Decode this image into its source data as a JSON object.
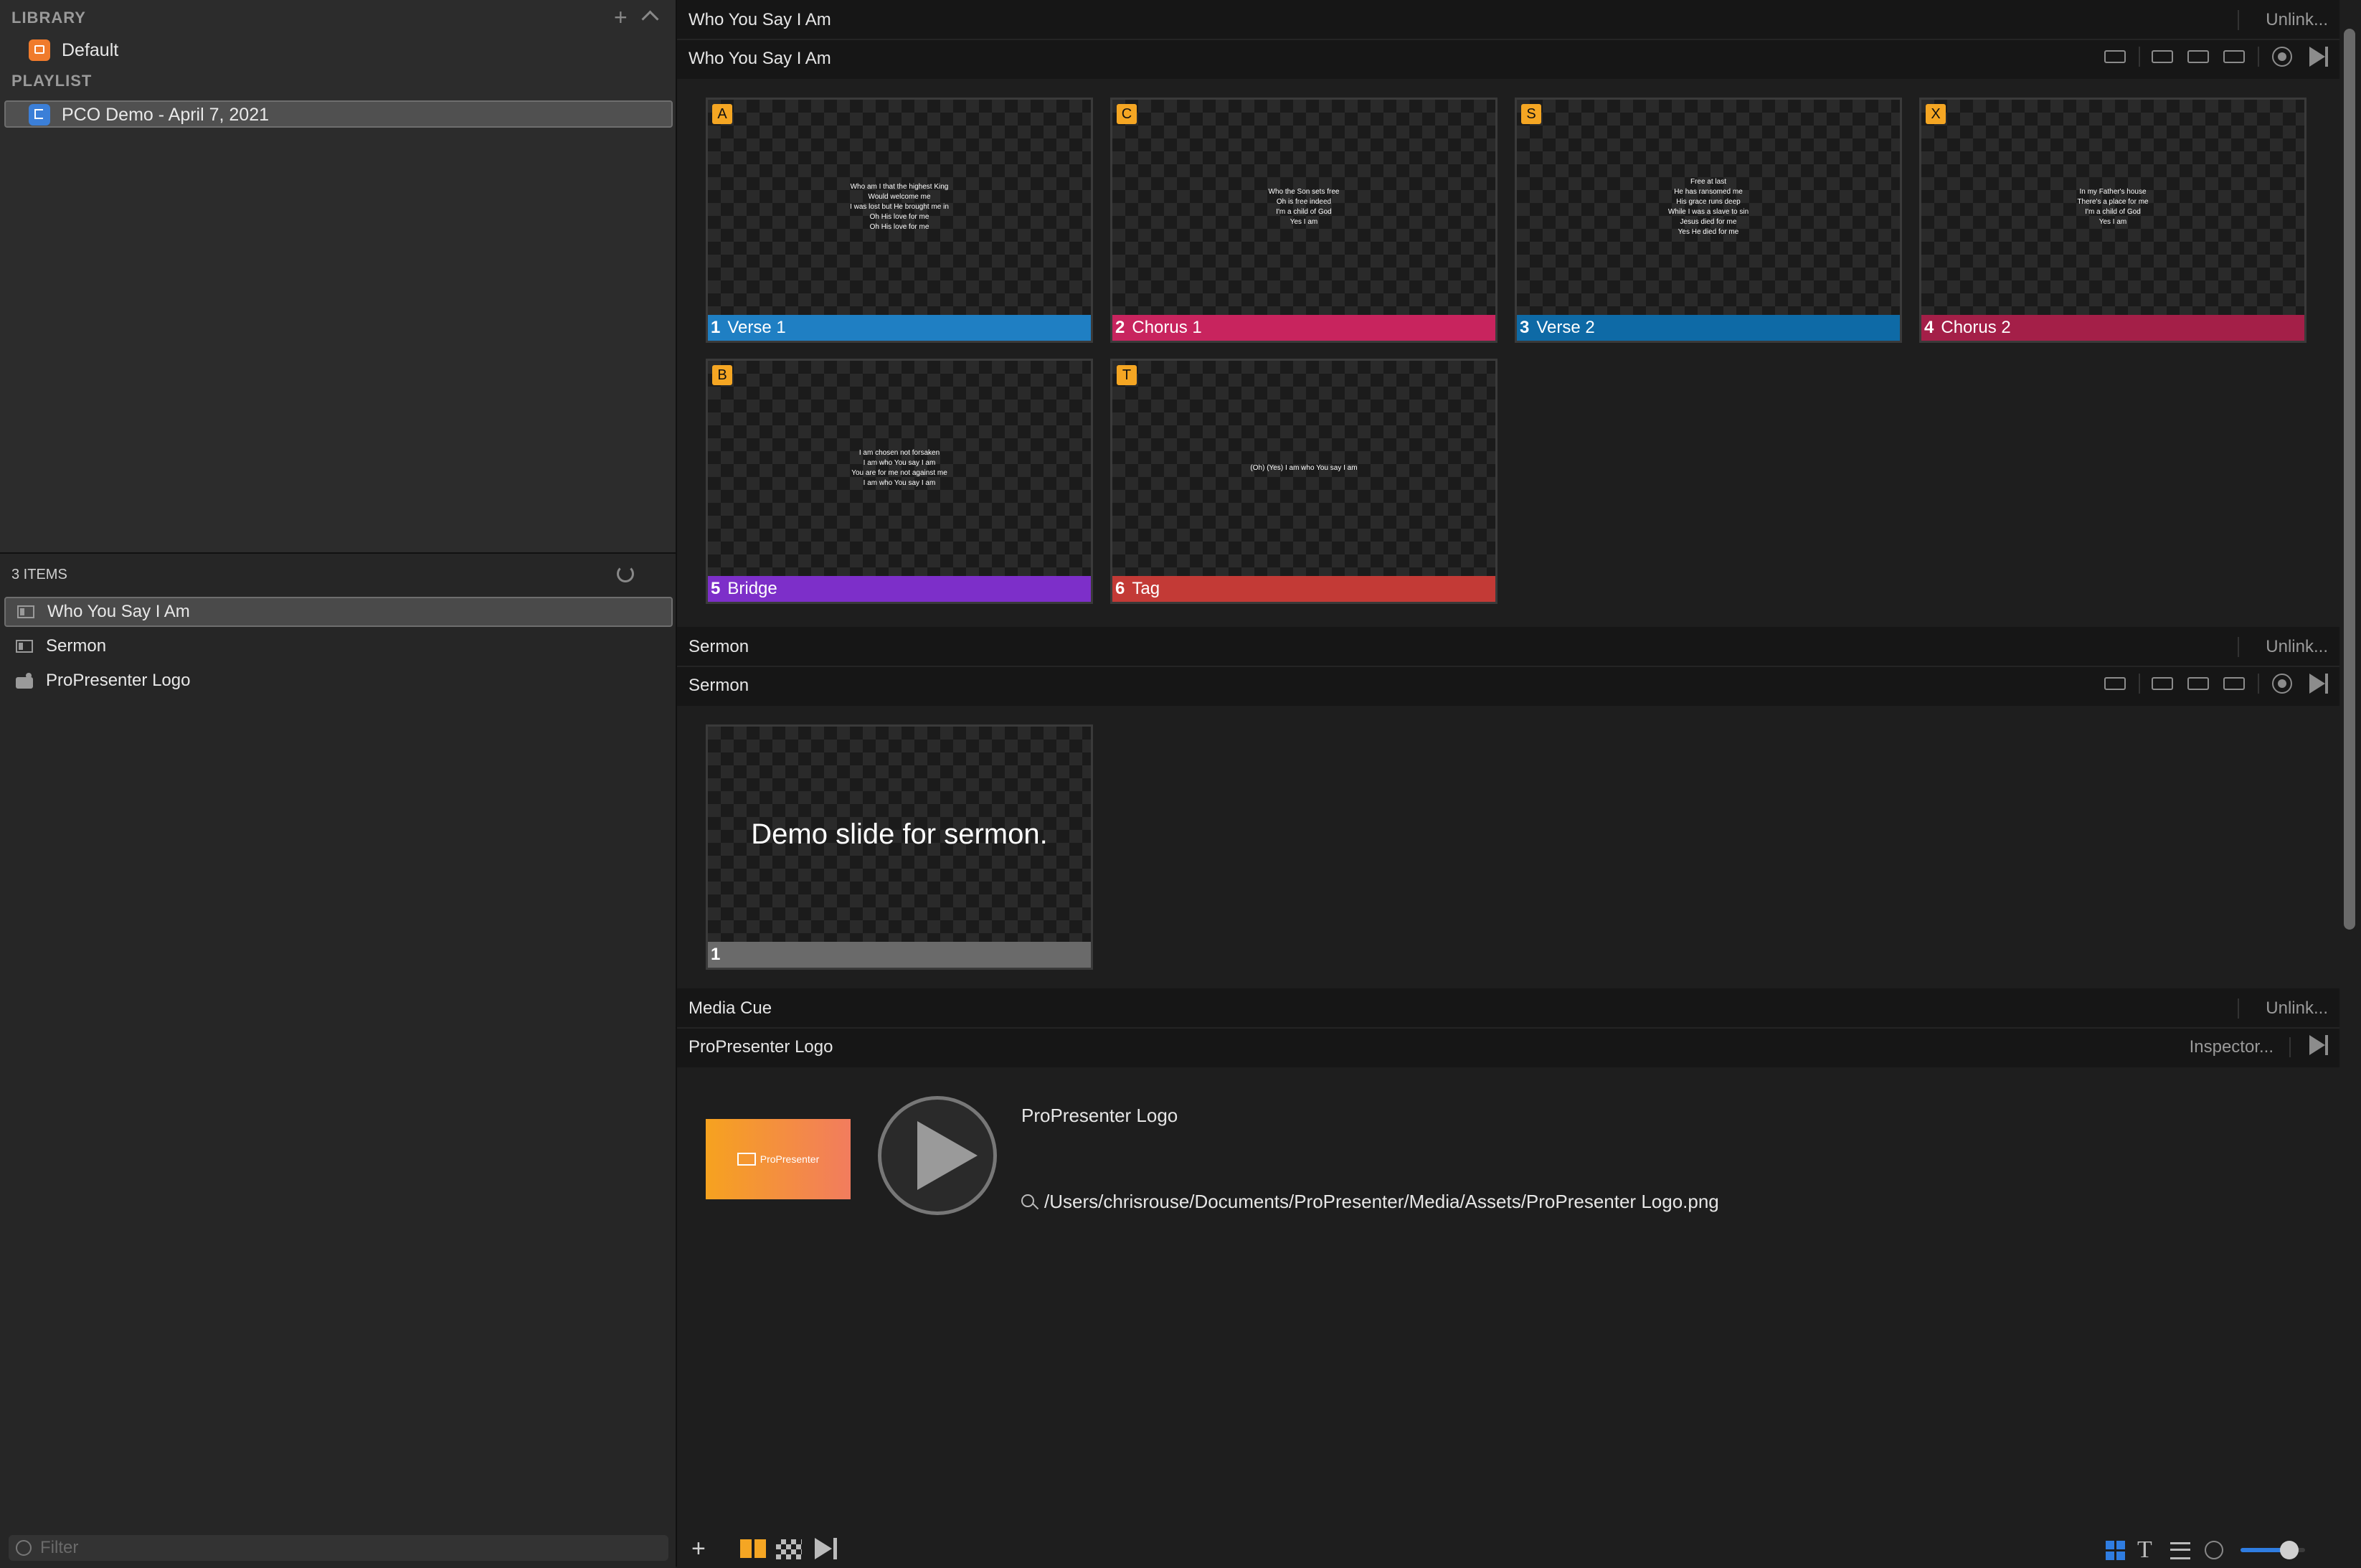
{
  "library": {
    "header": "LIBRARY",
    "items": [
      {
        "label": "Default"
      }
    ]
  },
  "playlist": {
    "header": "PLAYLIST",
    "items": [
      {
        "label": "PCO Demo - April 7, 2021",
        "selected": true
      }
    ]
  },
  "items_panel": {
    "count_label": "3 ITEMS",
    "items": [
      {
        "label": "Who You Say I Am",
        "icon": "document-icon",
        "selected": true
      },
      {
        "label": "Sermon",
        "icon": "document-icon"
      },
      {
        "label": "ProPresenter Logo",
        "icon": "image-icon"
      }
    ],
    "filter_placeholder": "Filter"
  },
  "sections": [
    {
      "group_title": "Who You Say I Am",
      "unlink_label": "Unlink...",
      "title": "Who You Say I Am",
      "slides": [
        {
          "badge": "A",
          "number": "1",
          "label": "Verse 1",
          "color": "#1f7fc3",
          "lyrics": "Who am I that the highest King\nWould welcome me\nI was lost but He brought me in\nOh His love for me\nOh His love for me"
        },
        {
          "badge": "C",
          "number": "2",
          "label": "Chorus 1",
          "color": "#c8245e",
          "lyrics": "Who the Son sets free\nOh is free indeed\nI'm a child of God\nYes I am"
        },
        {
          "badge": "S",
          "number": "3",
          "label": "Verse 2",
          "color": "#0e6aa6",
          "lyrics": "Free at last\nHe has ransomed me\nHis grace runs deep\nWhile I was a slave to sin\nJesus died for me\nYes He died for me"
        },
        {
          "badge": "X",
          "number": "4",
          "label": "Chorus 2",
          "color": "#a41f48",
          "lyrics": "In my Father's house\nThere's a place for me\nI'm a child of God\nYes I am"
        },
        {
          "badge": "B",
          "number": "5",
          "label": "Bridge",
          "color": "#7d2fc9",
          "lyrics": "I am chosen not forsaken\nI am who You say I am\nYou are for me not against me\nI am who You say I am"
        },
        {
          "badge": "T",
          "number": "6",
          "label": "Tag",
          "color": "#c33a36",
          "lyrics": "(Oh) (Yes) I am who You say I am"
        }
      ]
    },
    {
      "group_title": "Sermon",
      "unlink_label": "Unlink...",
      "title": "Sermon",
      "slides": [
        {
          "number": "1",
          "label": "",
          "color": "#6a6a6a",
          "text": "Demo slide for sermon."
        }
      ]
    }
  ],
  "media_cue": {
    "group_title": "Media Cue",
    "unlink_label": "Unlink...",
    "title": "ProPresenter Logo",
    "inspector_label": "Inspector...",
    "name": "ProPresenter Logo",
    "thumb_text": "ProPresenter",
    "path": "/Users/chrisrouse/Documents/ProPresenter/Media/Assets/ProPresenter Logo.png"
  },
  "bottom_toolbar": {
    "add_label": "+",
    "zoom_level": 0.75
  },
  "colors": {
    "accent": "#2f7de1",
    "badge": "#f5a623"
  }
}
